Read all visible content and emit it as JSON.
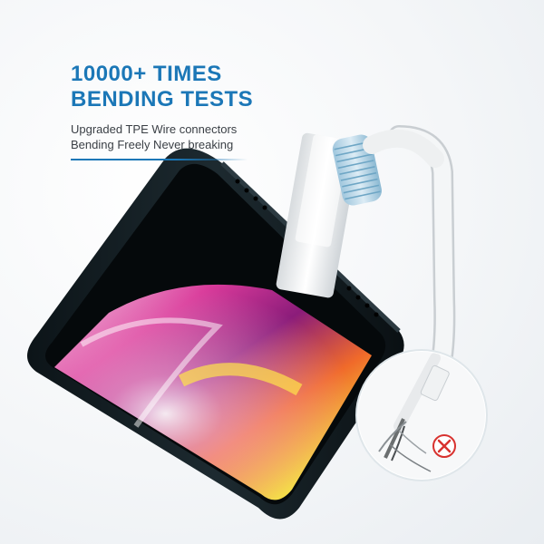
{
  "headline": {
    "line1": "10000+ TIMES",
    "line2": "BENDING TESTS"
  },
  "subtext": {
    "line1": "Upgraded TPE Wire connectors",
    "line2": "Bending Freely Never breaking"
  },
  "colors": {
    "accent": "#1b77b7",
    "error": "#d8322f",
    "text": "#3a3f45"
  },
  "icons": {
    "inset_badge": "x-mark-icon"
  }
}
